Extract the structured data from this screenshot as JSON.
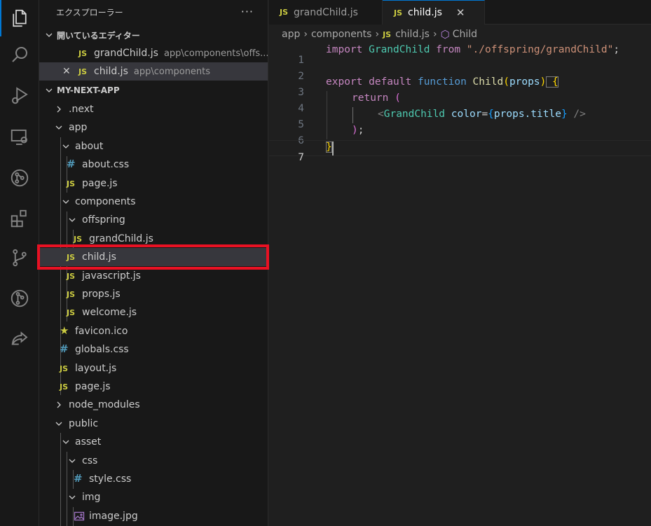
{
  "activity_bar": {
    "items": [
      {
        "name": "explorer-icon",
        "active": true
      },
      {
        "name": "search-icon",
        "active": false
      },
      {
        "name": "run-debug-icon",
        "active": false
      },
      {
        "name": "remote-explorer-icon",
        "active": false
      },
      {
        "name": "gitlens-icon",
        "active": false
      },
      {
        "name": "extensions-icon",
        "active": false
      },
      {
        "name": "source-control-icon",
        "active": false
      },
      {
        "name": "git-graph-icon",
        "active": false
      },
      {
        "name": "live-share-icon",
        "active": false
      }
    ]
  },
  "sidebar": {
    "title": "エクスプローラー",
    "more": "···",
    "open_editors": {
      "title": "開いているエディター",
      "items": [
        {
          "icon": "JS",
          "name": "grandChild.js",
          "path": "app\\components\\offs...",
          "close": ""
        },
        {
          "icon": "JS",
          "name": "child.js",
          "path": "app\\components",
          "close": "✕"
        }
      ]
    },
    "project": {
      "title": "MY-NEXT-APP",
      "tree": [
        {
          "label": ".next",
          "type": "folder",
          "expanded": false
        },
        {
          "label": "app",
          "type": "folder",
          "expanded": true
        },
        {
          "label": "about",
          "type": "folder",
          "expanded": true
        },
        {
          "label": "about.css",
          "type": "css",
          "icon": "#"
        },
        {
          "label": "page.js",
          "type": "js",
          "icon": "JS"
        },
        {
          "label": "components",
          "type": "folder",
          "expanded": true
        },
        {
          "label": "offspring",
          "type": "folder",
          "expanded": true
        },
        {
          "label": "grandChild.js",
          "type": "js",
          "icon": "JS"
        },
        {
          "label": "child.js",
          "type": "js",
          "icon": "JS",
          "selected": true
        },
        {
          "label": "javascript.js",
          "type": "js",
          "icon": "JS"
        },
        {
          "label": "props.js",
          "type": "js",
          "icon": "JS"
        },
        {
          "label": "welcome.js",
          "type": "js",
          "icon": "JS"
        },
        {
          "label": "favicon.ico",
          "type": "ico",
          "icon": "★"
        },
        {
          "label": "globals.css",
          "type": "css",
          "icon": "#"
        },
        {
          "label": "layout.js",
          "type": "js",
          "icon": "JS"
        },
        {
          "label": "page.js",
          "type": "js",
          "icon": "JS"
        },
        {
          "label": "node_modules",
          "type": "folder",
          "expanded": false
        },
        {
          "label": "public",
          "type": "folder",
          "expanded": true
        },
        {
          "label": "asset",
          "type": "folder",
          "expanded": true
        },
        {
          "label": "css",
          "type": "folder",
          "expanded": true
        },
        {
          "label": "style.css",
          "type": "css",
          "icon": "#"
        },
        {
          "label": "img",
          "type": "folder",
          "expanded": true
        },
        {
          "label": "image.jpg",
          "type": "image"
        }
      ]
    }
  },
  "tabs": [
    {
      "icon": "JS",
      "label": "grandChild.js",
      "active": false
    },
    {
      "icon": "JS",
      "label": "child.js",
      "active": true,
      "close": "✕"
    }
  ],
  "breadcrumbs": {
    "parts": [
      "app",
      "components"
    ],
    "file_icon": "JS",
    "file": "child.js",
    "symbol_icon": "⬡",
    "symbol": "Child",
    "sep": "›"
  },
  "editor": {
    "current_line": 7,
    "lines": [
      {
        "num": "1"
      },
      {
        "num": "2"
      },
      {
        "num": "3"
      },
      {
        "num": "4"
      },
      {
        "num": "5"
      },
      {
        "num": "6"
      },
      {
        "num": "7"
      }
    ],
    "tokens": {
      "l1_import": "import",
      "l1_cls": " GrandChild",
      "l1_from": " from",
      "l1_str": " \"./offspring/grandChild\"",
      "l1_semi": ";",
      "l3_export": "export",
      "l3_default": " default",
      "l3_function": " function",
      "l3_fn": " Child",
      "l3_open": "(",
      "l3_param": "props",
      "l3_close": ")",
      "l3_brace": " {",
      "l4_return": "return",
      "l4_paren": " (",
      "l5_lt": "<",
      "l5_cls": "GrandChild",
      "l5_attr": " color",
      "l5_eq": "=",
      "l5_ob": "{",
      "l5_expr": "props.title",
      "l5_cb": "}",
      "l5_end": " />",
      "l6_paren": ")",
      "l6_semi": ";",
      "l7_brace": "}"
    }
  }
}
